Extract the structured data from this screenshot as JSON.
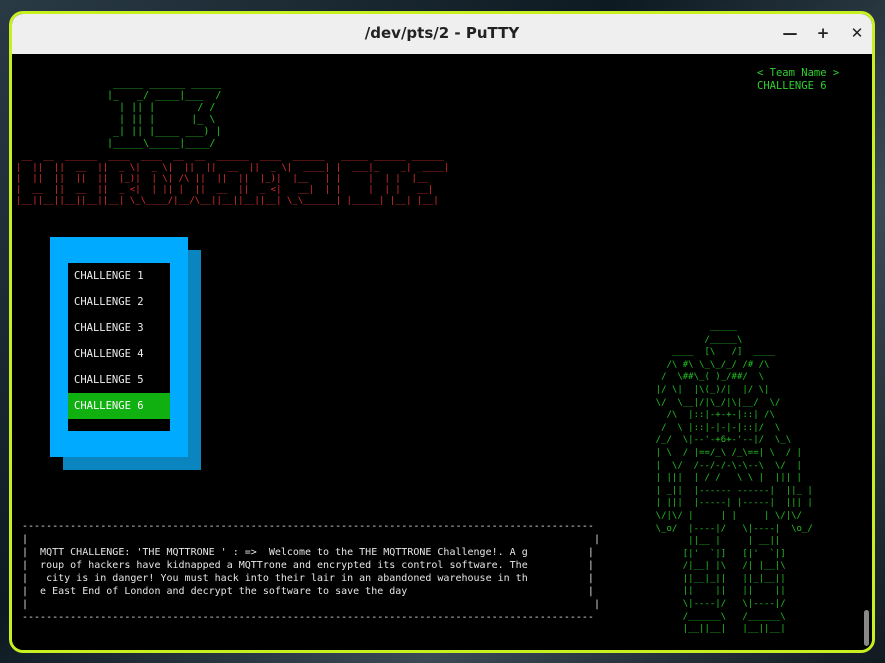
{
  "window": {
    "title": "/dev/pts/2 - PuTTY",
    "minimize_glyph": "—",
    "maximize_glyph": "+",
    "close_glyph": "✕"
  },
  "logo_ascii": " _____ ______ _____\n|_   _/ ____|___  /\n  | || |       / / \n  | || |      |_ \\ \n _| || |____ ___) |\n|_____\\_____|____/ ",
  "hardware_ascii": " __  __  ______  ____  ____  __  __  ______  ____  ______   _____ ______ ______\n|  ||  ||  __  ||  _ \\|  _ \\|  ||  ||  __  ||  _ \\|  ____| |  ___|_    _|  ____|\n|  ||  ||  ||  ||  |_)|  | \\| /\\ ||  ||  ||  |_)|  |__   | |     |  | |  |__\n|  __  ||  __  ||  _ <|  | || |  ||  __  ||  _ <|   __|  | |     |  | |   __|\n|__||__||__||__||__| \\_\\____/|__/\\__||__||__||__| \\_\\______| |_____| |__| |__|",
  "team": {
    "line1": "< Team Name >",
    "line2": "CHALLENGE 6"
  },
  "menu": {
    "items": [
      {
        "label": "CHALLENGE 1"
      },
      {
        "label": "CHALLENGE 2"
      },
      {
        "label": "CHALLENGE 3"
      },
      {
        "label": "CHALLENGE 4"
      },
      {
        "label": "CHALLENGE 5"
      },
      {
        "label": "CHALLENGE 6"
      }
    ],
    "selected_index": 5
  },
  "description_box": "-----------------------------------------------------------------------------------------------\n|                                                                                              |\n|  MQTT CHALLENGE: 'THE MQTTRONE ' : =>  Welcome to the THE MQTTRONE Challenge!. A g          |\n|  roup of hackers have kidnapped a MQTTrone and encrypted its control software. The          |\n|   city is in danger! You must hack into their lair in an abandoned warehouse in th          |\n|  e East End of London and decrypt the software to save the day                              |\n|                                                                                              |\n-----------------------------------------------------------------------------------------------",
  "robot_ascii": "              _____\n             /_____\\\n       ____  [\\   /]  ____\n      /\\ #\\ \\_\\_/_/ /# /\\\n     /  \\##\\_( )_/##/  \\\n    |/ \\|  |\\(_)/|  |/ \\|\n    \\/  \\__|/|\\_/|\\|__/  \\/\n      /\\  |::|-+-+-|::| /\\\n     /  \\ |::|-|-|-|::|/  \\\n    /_/  \\|--'-+6+-'--|/  \\_\\\n    | \\  / |==/_\\ /_\\==| \\  / |\n    |  \\/  /--/-/-\\-\\--\\  \\/  |\n    | |||  | / /   \\ \\ |  ||| |\n    | _||  |------ ------|  ||_ |\n    | |||  |-----| |-----|  ||| |\n    \\/|\\/ |     | |     | \\/|\\/\n    \\_o/  |----|/   \\|----|  \\o_/\n          ||__ |     | __||\n         [|'  `|]   [|'  `|]\n         /|__| |\\   /| |__|\\\n         ||__|_||   ||_|__||\n         ||    ||   ||    ||\n         \\|----|/   \\|----|/\n         /______\\   /______\\\n         |__||__|   |__||__|"
}
